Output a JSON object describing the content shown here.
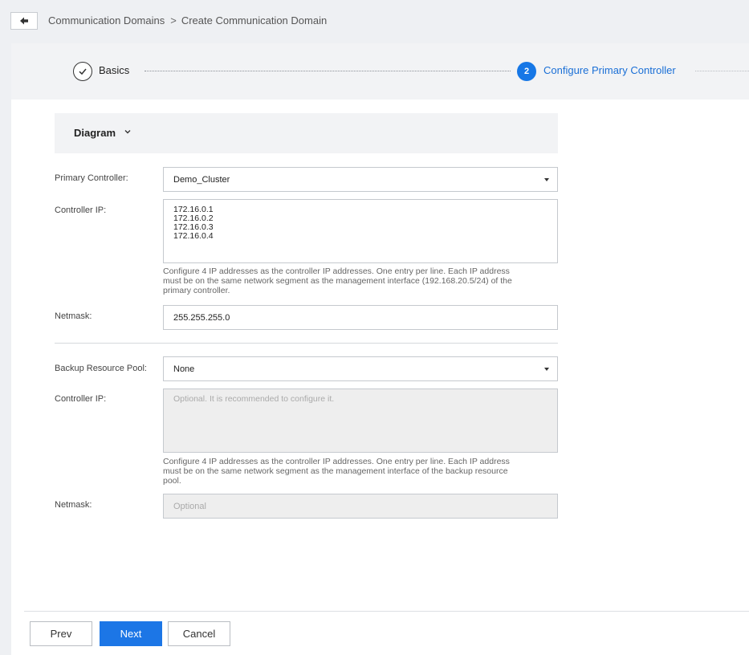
{
  "breadcrumb": {
    "parent": "Communication Domains",
    "separator": ">",
    "current": "Create Communication Domain"
  },
  "steps": [
    {
      "number": "1",
      "label": "Basics",
      "status": "completed"
    },
    {
      "number": "2",
      "label": "Configure Primary Controller",
      "status": "active"
    }
  ],
  "diagram": {
    "label": "Diagram",
    "icon": "chevron-down-icon"
  },
  "primary": {
    "controller_label": "Primary Controller:",
    "controller_value": "Demo_Cluster",
    "ip_label": "Controller IP:",
    "ips": [
      "172.16.0.1",
      "172.16.0.2",
      "172.16.0.3",
      "172.16.0.4"
    ],
    "ip_hint_lines": [
      "Configure 4 IP addresses as the controller IP addresses. One entry per line. Each IP address",
      "must be on the same network segment as the management interface (192.168.20.5/24) of the",
      "primary controller."
    ],
    "netmask_label": "Netmask:",
    "netmask_value": "255.255.255.0"
  },
  "backup": {
    "pool_label": "Backup Resource Pool:",
    "pool_value": "None",
    "ip_label": "Controller IP:",
    "ip_placeholder": "Optional. It is recommended to configure it.",
    "ip_hint_lines": [
      "Configure 4 IP addresses as the controller IP addresses. One entry per line. Each IP address",
      "must be on the same network segment as the management interface of the backup resource",
      "pool."
    ],
    "netmask_label": "Netmask:",
    "netmask_placeholder": "Optional"
  },
  "buttons": {
    "prev": "Prev",
    "next": "Next",
    "cancel": "Cancel"
  },
  "colors": {
    "accent": "#1677e6",
    "active_text": "#1a6fd6"
  }
}
